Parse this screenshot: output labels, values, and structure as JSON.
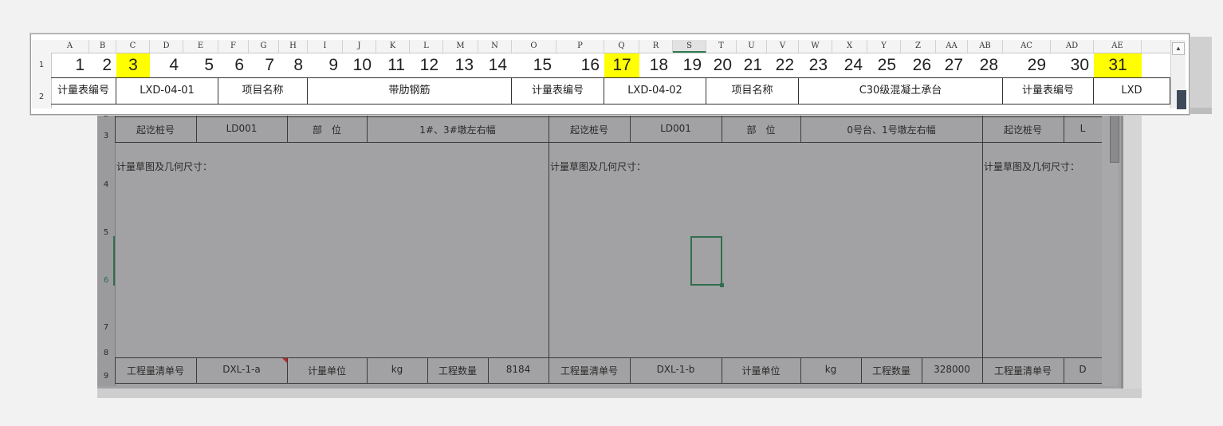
{
  "front": {
    "row_labels": [
      "1",
      "2"
    ],
    "columns": [
      {
        "letter": "A",
        "value": "1",
        "w": 48
      },
      {
        "letter": "B",
        "value": "2",
        "w": 34
      },
      {
        "letter": "C",
        "value": "3",
        "w": 42,
        "highlight": true
      },
      {
        "letter": "D",
        "value": "4",
        "w": 42
      },
      {
        "letter": "E",
        "value": "5",
        "w": 44
      },
      {
        "letter": "F",
        "value": "6",
        "w": 38
      },
      {
        "letter": "G",
        "value": "7",
        "w": 38
      },
      {
        "letter": "H",
        "value": "8",
        "w": 36
      },
      {
        "letter": "I",
        "value": "9",
        "w": 44
      },
      {
        "letter": "J",
        "value": "10",
        "w": 42
      },
      {
        "letter": "K",
        "value": "11",
        "w": 42
      },
      {
        "letter": "L",
        "value": "12",
        "w": 42
      },
      {
        "letter": "M",
        "value": "13",
        "w": 44
      },
      {
        "letter": "N",
        "value": "14",
        "w": 42
      },
      {
        "letter": "O",
        "value": "15",
        "w": 56
      },
      {
        "letter": "P",
        "value": "16",
        "w": 60
      },
      {
        "letter": "Q",
        "value": "17",
        "w": 44,
        "highlight": true
      },
      {
        "letter": "R",
        "value": "18",
        "w": 42
      },
      {
        "letter": "S",
        "value": "19",
        "w": 42,
        "selected": true
      },
      {
        "letter": "T",
        "value": "20",
        "w": 38
      },
      {
        "letter": "U",
        "value": "21",
        "w": 38
      },
      {
        "letter": "V",
        "value": "22",
        "w": 40
      },
      {
        "letter": "W",
        "value": "23",
        "w": 42
      },
      {
        "letter": "X",
        "value": "24",
        "w": 44
      },
      {
        "letter": "Y",
        "value": "25",
        "w": 42
      },
      {
        "letter": "Z",
        "value": "26",
        "w": 44
      },
      {
        "letter": "AA",
        "value": "27",
        "w": 40
      },
      {
        "letter": "AB",
        "value": "28",
        "w": 44
      },
      {
        "letter": "AC",
        "value": "29",
        "w": 60
      },
      {
        "letter": "AD",
        "value": "30",
        "w": 54
      },
      {
        "letter": "AE",
        "value": "31",
        "w": 60,
        "highlight": true
      }
    ],
    "row2": [
      {
        "text": "计量表编号",
        "span": 2
      },
      {
        "text": "LXD-04-01",
        "span": 3
      },
      {
        "text": "项目名称",
        "span": 3
      },
      {
        "text": "带肋钢筋",
        "span": 6
      },
      {
        "text": "计量表编号",
        "span": 2
      },
      {
        "text": "LXD-04-02",
        "span": 3
      },
      {
        "text": "项目名称",
        "span": 3
      },
      {
        "text": "C30级混凝土承台",
        "span": 6
      },
      {
        "text": "计量表编号",
        "span": 2
      },
      {
        "text": "LXD",
        "span": 1
      }
    ]
  },
  "back": {
    "row_labels": [
      "2",
      "3",
      "4",
      "5",
      "6",
      "7",
      "8",
      "9"
    ],
    "row3": [
      "起讫桩号",
      "LD001",
      "部　位",
      "1#、3#墩左右幅",
      "起讫桩号",
      "LD001",
      "部　位",
      "0号台、1号墩左右幅",
      "起讫桩号",
      "L"
    ],
    "sketch_label": "计量草图及几何尺寸：",
    "row9": [
      "工程量清单号",
      "DXL-1-a",
      "计量单位",
      "kg",
      "工程数量",
      "8184",
      "工程量清单号",
      "DXL-1-b",
      "计量单位",
      "kg",
      "工程数量",
      "328000",
      "工程量清单号",
      "D"
    ]
  },
  "colors": {
    "highlight": "#ffff00",
    "selection": "#2f6f4f",
    "dim_sheet": "#a2a1a3"
  }
}
